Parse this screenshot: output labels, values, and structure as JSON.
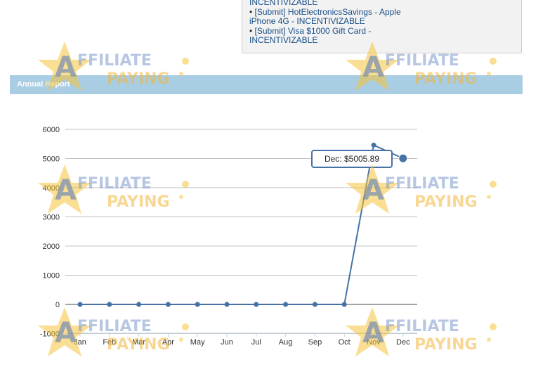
{
  "notifications": {
    "lines": [
      {
        "text": "INCENTIVIZABLE",
        "bullet": false
      },
      {
        "text": "[Submit] HotElectronicsSavings - Apple",
        "bullet": true
      },
      {
        "text": "iPhone 4G - INCENTIVIZABLE",
        "bullet": false
      },
      {
        "text": "[Submit] Visa $1000 Gift Card -",
        "bullet": true
      },
      {
        "text": "INCENTIVIZABLE",
        "bullet": false
      }
    ],
    "bullet_char": "•"
  },
  "section": {
    "title_part1": "Annual ",
    "title_part2": "R",
    "title_part3": "eport"
  },
  "watermark": {
    "letter": "A",
    "word1": "FFILIATE",
    "word2": "PAYING"
  },
  "chart_data": {
    "type": "line",
    "title": "",
    "xlabel": "",
    "ylabel": "",
    "categories": [
      "Jan",
      "Feb",
      "Mar",
      "Apr",
      "May",
      "Jun",
      "Jul",
      "Aug",
      "Sep",
      "Oct",
      "Nov",
      "Dec"
    ],
    "series": [
      {
        "values": [
          0,
          0,
          0,
          0,
          0,
          0,
          0,
          0,
          0,
          0,
          5460,
          5005.89
        ]
      }
    ],
    "ylim": [
      -1000,
      6000
    ],
    "yticks": [
      -1000,
      0,
      1000,
      2000,
      3000,
      4000,
      5000,
      6000
    ],
    "grid": true,
    "tooltip": {
      "text": "Dec: $5005.89",
      "category": "Dec"
    },
    "colors": {
      "line": "#4572a7",
      "grid": "#c0c0c0",
      "axis_text": "#333333"
    }
  }
}
